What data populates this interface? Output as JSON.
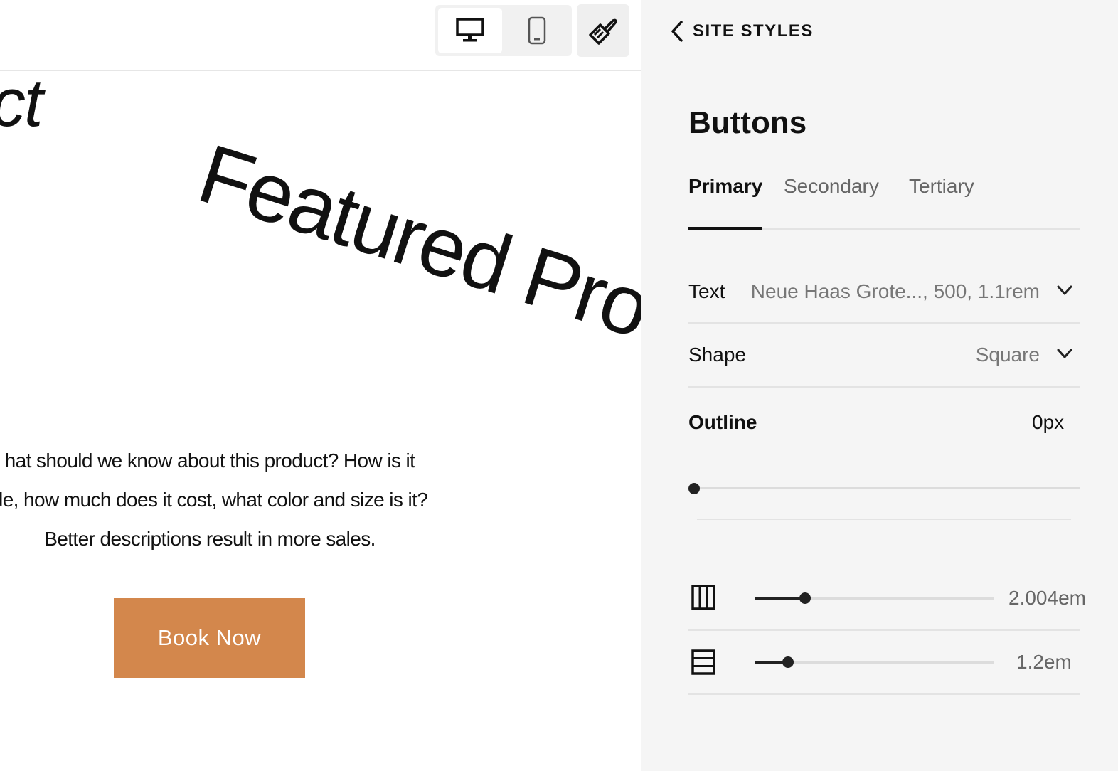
{
  "canvas": {
    "title_fragment": "ct",
    "featured_title": "Featured Produ",
    "description_lines": [
      "hat should we know about this product? How is it",
      "de, how much does it cost, what color and size is it?",
      "Better descriptions result in more sales."
    ],
    "button_label": "Book Now",
    "button_color": "#d3874c"
  },
  "toolbar": {
    "desktop_icon": "desktop-monitor-icon",
    "mobile_icon": "mobile-phone-icon",
    "style_icon": "paintbrush-icon",
    "active_view": "desktop"
  },
  "panel": {
    "back_label": "SITE STYLES",
    "title": "Buttons",
    "tabs": [
      {
        "label": "Primary",
        "active": true
      },
      {
        "label": "Secondary",
        "active": false
      },
      {
        "label": "Tertiary",
        "active": false
      }
    ],
    "text_row": {
      "label": "Text",
      "value": "Neue Haas Grote..., 500, 1.1rem"
    },
    "shape_row": {
      "label": "Shape",
      "value": "Square"
    },
    "outline": {
      "label": "Outline",
      "value": "0px",
      "level": 0
    },
    "padding_horizontal": {
      "icon": "padding-horizontal-icon",
      "value": "2.004em",
      "level": 0.21
    },
    "padding_vertical": {
      "icon": "padding-vertical-icon",
      "value": "1.2em",
      "level": 0.14
    }
  }
}
